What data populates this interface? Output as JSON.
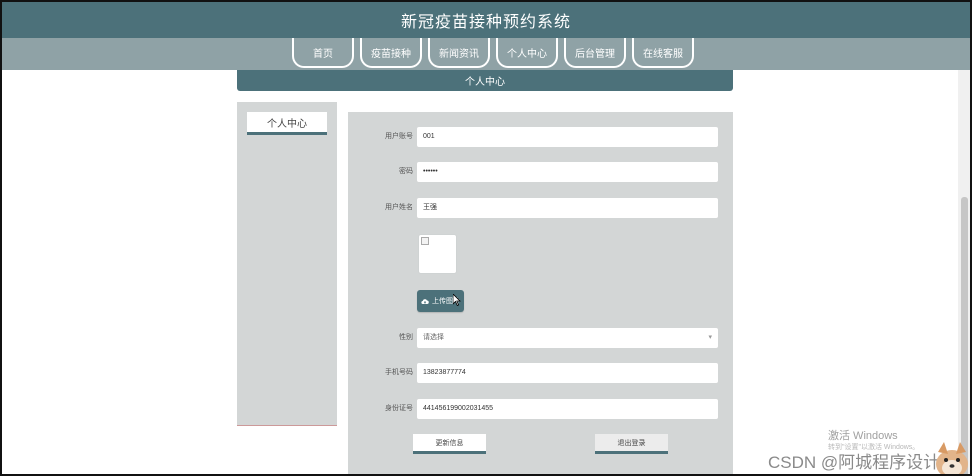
{
  "header": {
    "title": "新冠疫苗接种预约系统"
  },
  "nav": {
    "items": [
      {
        "label": "首页"
      },
      {
        "label": "疫苗接种"
      },
      {
        "label": "新闻资讯"
      },
      {
        "label": "个人中心"
      },
      {
        "label": "后台管理"
      },
      {
        "label": "在线客服"
      }
    ]
  },
  "section": {
    "title": "个人中心"
  },
  "sidebar": {
    "tab_label": "个人中心"
  },
  "form": {
    "account": {
      "label": "用户账号",
      "value": "001"
    },
    "password": {
      "label": "密码",
      "value": "••••••"
    },
    "name": {
      "label": "用户姓名",
      "value": "王强"
    },
    "upload": {
      "label": "上传图片"
    },
    "gender": {
      "label": "性别",
      "placeholder": "请选择"
    },
    "phone": {
      "label": "手机号码",
      "value": "13823877774"
    },
    "idcard": {
      "label": "身份证号",
      "value": "441456199002031455"
    },
    "update_label": "更新信息",
    "logout_label": "退出登录"
  },
  "watermark": {
    "line1": "激活 Windows",
    "line2": "转到\"设置\"以激活 Windows。"
  },
  "credit": "CSDN @阿城程序设计",
  "colors": {
    "primary": "#4c717a",
    "nav_strip": "#8fa2a6",
    "panel": "#d3d6d6"
  },
  "icons": {
    "upload": "cloud-upload-icon",
    "select": "chevron-down-icon"
  }
}
